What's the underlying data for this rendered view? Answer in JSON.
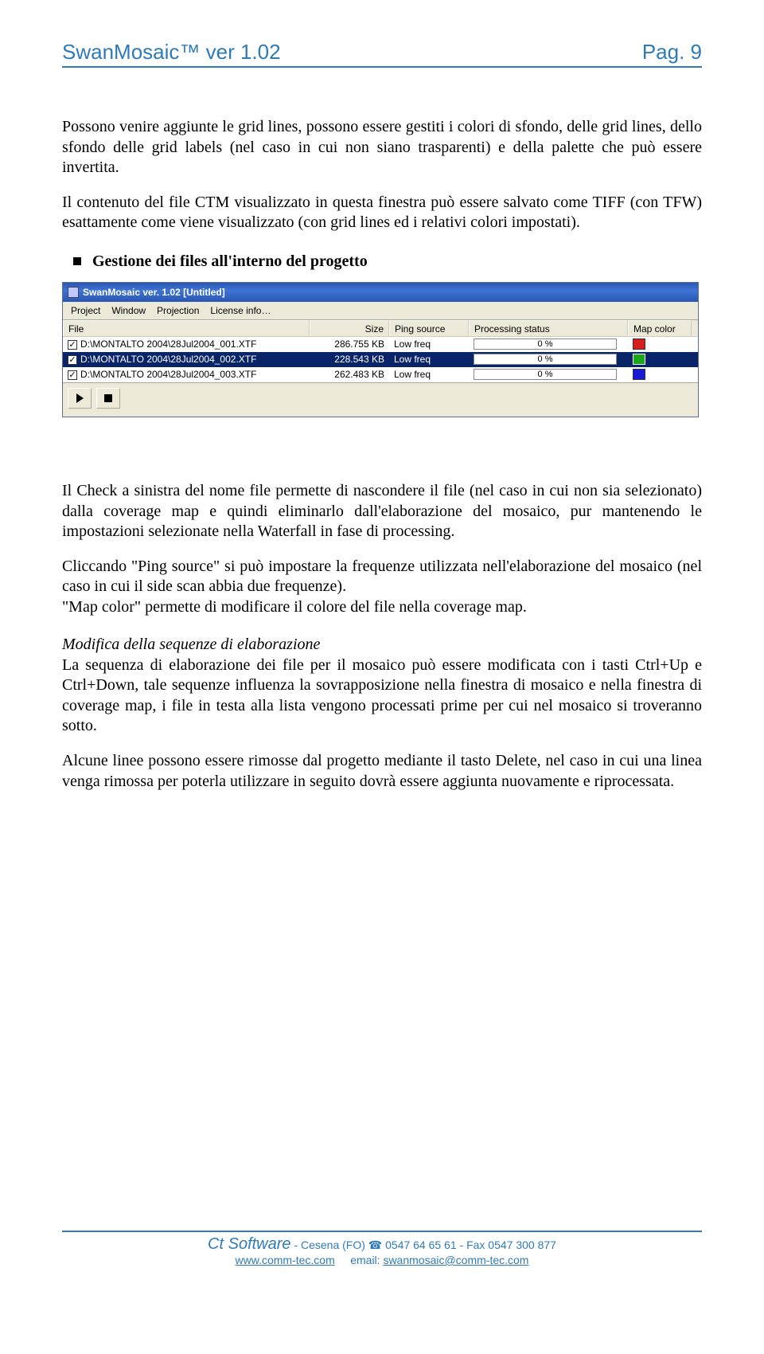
{
  "header": {
    "left": "SwanMosaic™ ver 1.02",
    "right": "Pag. 9"
  },
  "para1": "Possono venire aggiunte le grid lines, possono essere gestiti i colori di sfondo, delle grid lines, dello sfondo delle grid labels (nel caso in cui non siano trasparenti) e della palette che può essere invertita.",
  "para2": "Il contenuto del file CTM visualizzato in questa finestra può essere salvato come TIFF (con TFW) esattamente come viene visualizzato (con grid lines ed i relativi colori impostati).",
  "section_title": "Gestione dei files all'interno del progetto",
  "app": {
    "title": "SwanMosaic ver. 1.02 [Untitled]",
    "menus": [
      "Project",
      "Window",
      "Projection",
      "License info…"
    ],
    "columns": {
      "file": "File",
      "size": "Size",
      "ping": "Ping source",
      "proc": "Processing status",
      "color": "Map color"
    },
    "rows": [
      {
        "checked": true,
        "file": "D:\\MONTALTO 2004\\28Jul2004_001.XTF",
        "size": "286.755 KB",
        "ping": "Low freq",
        "proc": "0 %",
        "color": "#d61f1f",
        "selected": false
      },
      {
        "checked": true,
        "file": "D:\\MONTALTO 2004\\28Jul2004_002.XTF",
        "size": "228.543 KB",
        "ping": "Low freq",
        "proc": "0 %",
        "color": "#1aa81a",
        "selected": true
      },
      {
        "checked": true,
        "file": "D:\\MONTALTO 2004\\28Jul2004_003.XTF",
        "size": "262.483 KB",
        "ping": "Low freq",
        "proc": "0 %",
        "color": "#1818d8",
        "selected": false
      }
    ]
  },
  "para3": "Il Check a sinistra del nome file permette di nascondere il file (nel caso in cui non sia selezionato) dalla coverage map e quindi eliminarlo dall'elaborazione del mosaico, pur mantenendo le impostazioni selezionate nella Waterfall in fase di processing.",
  "para4": " Cliccando \"Ping source\" si può impostare la frequenze utilizzata nell'elaborazione del mosaico (nel caso in cui il side scan abbia due frequenze).",
  "para5": "\"Map color\" permette di modificare il colore del file nella coverage map.",
  "subheading": "Modifica della sequenze di elaborazione",
  "para6": "La sequenza di elaborazione dei file per il mosaico può essere modificata con i tasti Ctrl+Up e Ctrl+Down, tale sequenze influenza la sovrapposizione nella finestra di mosaico e nella finestra di coverage map, i file in testa alla lista vengono processati prime per cui nel mosaico si troveranno sotto.",
  "para7": "Alcune linee possono essere rimosse dal progetto mediante il tasto Delete, nel caso in cui una linea venga rimossa per poterla utilizzare in seguito dovrà essere aggiunta nuovamente e riprocessata.",
  "footer": {
    "company": "Ct Software",
    "rest": " - Cesena (FO) ☎ 0547 64 65 61 - Fax 0547 300 877",
    "site": "www.comm-tec.com",
    "email_label": "email: ",
    "email": "swanmosaic@comm-tec.com"
  }
}
